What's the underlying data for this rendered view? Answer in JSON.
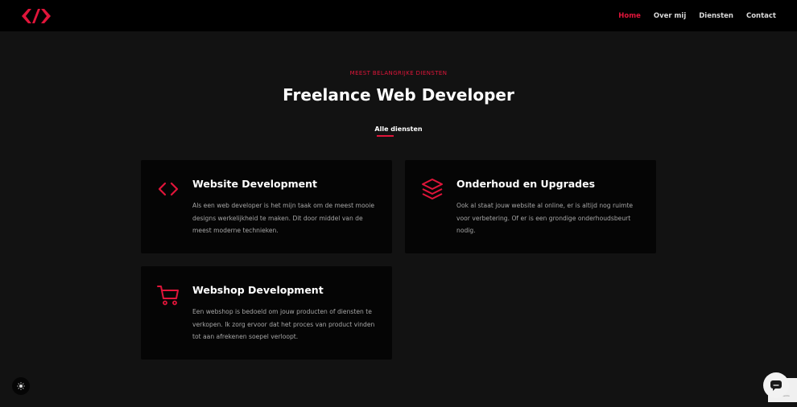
{
  "colors": {
    "accent": "#e0153a",
    "header_bg": "#000000",
    "page_bg": "#121212",
    "card_bg": "#050505"
  },
  "header": {
    "logo_icon": "code-brackets-logo",
    "nav": [
      {
        "label": "Home",
        "active": true
      },
      {
        "label": "Over mij",
        "active": false
      },
      {
        "label": "Diensten",
        "active": false
      },
      {
        "label": "Contact",
        "active": false
      }
    ]
  },
  "hero": {
    "eyebrow": "MEEST BELANGRIJKE DIENSTEN",
    "title": "Freelance Web Developer",
    "all_link": "Alle diensten"
  },
  "services": [
    {
      "icon": "code-icon",
      "title": "Website Development",
      "text": "Als een web developer is het mijn taak om de meest mooie designs werkelijkheid te maken. Dit door middel van de meest moderne technieken."
    },
    {
      "icon": "layers-icon",
      "title": "Onderhoud en Upgrades",
      "text": "Ook al staat jouw website al online, er is altijd nog ruimte voor verbetering. Of er is een grondige onderhoudsbeurt nodig."
    },
    {
      "icon": "cart-icon",
      "title": "Webshop Development",
      "text": "Een webshop is bedoeld om jouw producten of diensten te verkopen. Ik zorg ervoor dat het proces van product vinden tot aan afrekenen soepel verloopt."
    }
  ],
  "widgets": {
    "theme_icon": "sun-icon",
    "chat_icon": "chat-icon",
    "recaptcha_text": "Privacy - Terms"
  }
}
